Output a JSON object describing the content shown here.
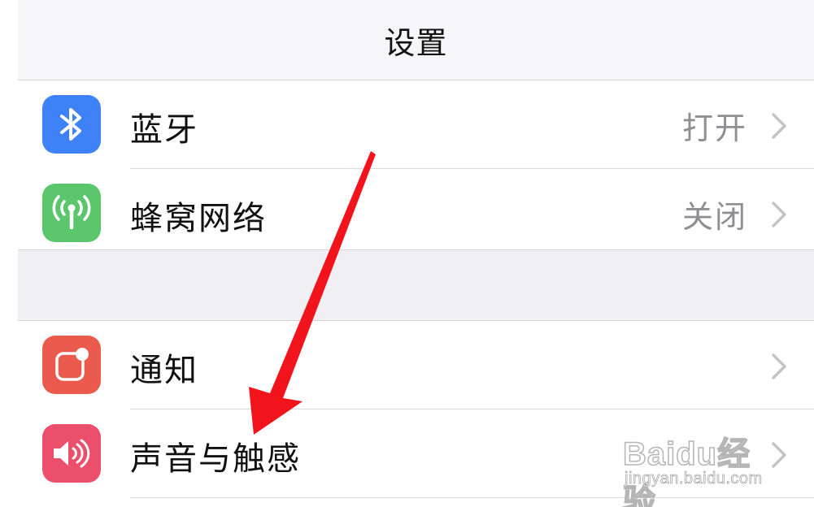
{
  "nav": {
    "title": "设置"
  },
  "group1": {
    "items": [
      {
        "label": "蓝牙",
        "value": "打开",
        "icon": "bluetooth-icon",
        "icon_color": "#3f82f7"
      },
      {
        "label": "蜂窝网络",
        "value": "关闭",
        "icon": "antenna-icon",
        "icon_color": "#5bc66b"
      }
    ]
  },
  "group2": {
    "items": [
      {
        "label": "通知",
        "value": "",
        "icon": "notification-icon",
        "icon_color": "#ea5b4e"
      },
      {
        "label": "声音与触感",
        "value": "",
        "icon": "speaker-icon",
        "icon_color": "#ec4f6b"
      }
    ]
  },
  "annotation": {
    "arrow_color": "#f2141c"
  },
  "watermark": {
    "brand": "Baidu经验",
    "url": "jingyan.baidu.com"
  }
}
